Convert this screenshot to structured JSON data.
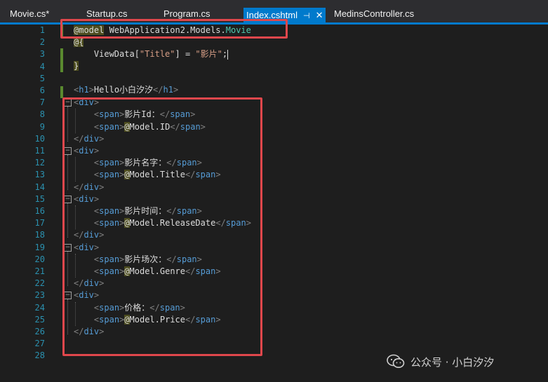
{
  "tabs": [
    {
      "label": "Movie.cs*",
      "active": false
    },
    {
      "label": "Startup.cs",
      "active": false
    },
    {
      "label": "Program.cs",
      "active": false
    },
    {
      "label": "Index.cshtml",
      "active": true,
      "pin": "⊣",
      "close": "✕"
    },
    {
      "label": "MedinsController.cs",
      "active": false
    }
  ],
  "editor": {
    "lines": [
      {
        "num": "1"
      },
      {
        "num": "2"
      },
      {
        "num": "3"
      },
      {
        "num": "4"
      },
      {
        "num": "5"
      },
      {
        "num": "6"
      },
      {
        "num": "7"
      },
      {
        "num": "8"
      },
      {
        "num": "9"
      },
      {
        "num": "10"
      },
      {
        "num": "11"
      },
      {
        "num": "12"
      },
      {
        "num": "13"
      },
      {
        "num": "14"
      },
      {
        "num": "15"
      },
      {
        "num": "16"
      },
      {
        "num": "17"
      },
      {
        "num": "18"
      },
      {
        "num": "19"
      },
      {
        "num": "20"
      },
      {
        "num": "21"
      },
      {
        "num": "22"
      },
      {
        "num": "23"
      },
      {
        "num": "24"
      },
      {
        "num": "25"
      },
      {
        "num": "26"
      },
      {
        "num": "27"
      },
      {
        "num": "28"
      }
    ],
    "code": {
      "l1_model": "@model",
      "l1_ns": " WebApplication2.Models.",
      "l1_type": "Movie",
      "l2": "@{",
      "l3_a": "    ViewData[",
      "l3_str1": "\"Title\"",
      "l3_b": "] = ",
      "l3_str2": "\"影片\"",
      "l3_c": ";",
      "l4": "}",
      "l6_open": "<",
      "l6_tag": "h1",
      "l6_gt": ">",
      "l6_text": "Hello小白汐汐",
      "l6_close_lt": "</",
      "l6_close_tag": "h1",
      "l6_close_gt": ">",
      "blocks": [
        {
          "label": "影片Id：",
          "razor": "@",
          "prop": "Model.ID"
        },
        {
          "label": "影片名字：",
          "razor": "@",
          "prop": "Model.Title"
        },
        {
          "label": "影片时间：",
          "razor": "@",
          "prop": "Model.ReleaseDate"
        },
        {
          "label": "影片场次：",
          "razor": "@",
          "prop": "Model.Genre"
        },
        {
          "label": "价格：",
          "razor": "@",
          "prop": "Model.Price"
        }
      ],
      "div": "div",
      "span": "span"
    }
  },
  "watermark": {
    "text": "公众号 · 小白汐汐"
  },
  "colors": {
    "highlight_box": "#e0474c",
    "line_number": "#2b91af",
    "accent": "#007acc"
  }
}
